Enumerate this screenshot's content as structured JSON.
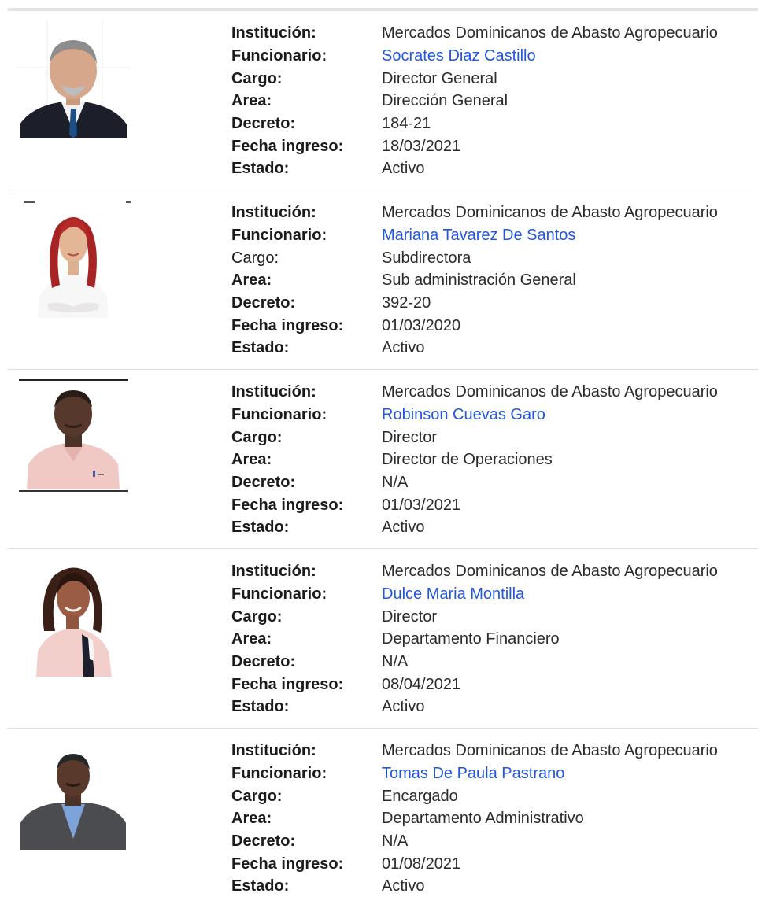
{
  "labels": {
    "institucion": "Institución:",
    "funcionario": "Funcionario:",
    "cargo": "Cargo:",
    "area": "Area:",
    "decreto": "Decreto:",
    "fecha_ingreso": "Fecha ingreso:",
    "estado": "Estado:"
  },
  "colors": {
    "link": "#2256e0",
    "divider": "#dcdcdc",
    "text": "#222222"
  },
  "records": [
    {
      "institucion": "Mercados Dominicanos de Abasto Agropecuario",
      "funcionario": "Socrates Diaz Castillo",
      "cargo": "Director General",
      "area": "Dirección General",
      "decreto": "184-21",
      "fecha_ingreso": "18/03/2021",
      "estado": "Activo",
      "photo_icon": "portrait-man-suit-icon"
    },
    {
      "institucion": "Mercados Dominicanos de Abasto Agropecuario",
      "funcionario": "Mariana Tavarez De Santos",
      "cargo": "Subdirectora",
      "area": "Sub administración General",
      "decreto": "392-20",
      "fecha_ingreso": "01/03/2020",
      "estado": "Activo",
      "photo_icon": "portrait-woman-red-hair-icon"
    },
    {
      "institucion": "Mercados Dominicanos de Abasto Agropecuario",
      "funcionario": "Robinson Cuevas Garo",
      "cargo": "Director",
      "area": "Director de Operaciones",
      "decreto": "N/A",
      "fecha_ingreso": "01/03/2021",
      "estado": "Activo",
      "photo_icon": "portrait-man-pink-shirt-icon"
    },
    {
      "institucion": "Mercados Dominicanos de Abasto Agropecuario",
      "funcionario": "Dulce Maria Montilla",
      "cargo": "Director",
      "area": "Departamento Financiero",
      "decreto": "N/A",
      "fecha_ingreso": "08/04/2021",
      "estado": "Activo",
      "photo_icon": "portrait-woman-pink-blazer-icon"
    },
    {
      "institucion": "Mercados Dominicanos de Abasto Agropecuario",
      "funcionario": "Tomas De Paula Pastrano",
      "cargo": "Encargado",
      "area": "Departamento Administrativo",
      "decreto": "N/A",
      "fecha_ingreso": "01/08/2021",
      "estado": "Activo",
      "photo_icon": "portrait-man-gray-suit-icon"
    }
  ]
}
